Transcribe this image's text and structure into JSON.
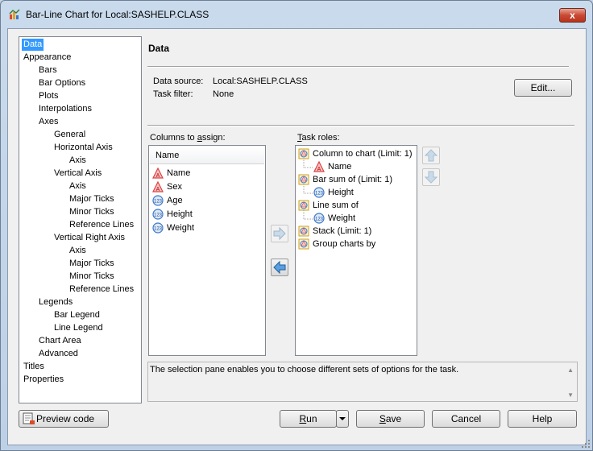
{
  "window": {
    "title": "Bar-Line Chart for Local:SASHELP.CLASS",
    "close_label": "x"
  },
  "tree": {
    "items": [
      {
        "label": "Data",
        "level": 0,
        "selected": true
      },
      {
        "label": "Appearance",
        "level": 0
      },
      {
        "label": "Bars",
        "level": 1
      },
      {
        "label": "Bar Options",
        "level": 1
      },
      {
        "label": "Plots",
        "level": 1
      },
      {
        "label": "Interpolations",
        "level": 1
      },
      {
        "label": "Axes",
        "level": 1
      },
      {
        "label": "General",
        "level": 2
      },
      {
        "label": "Horizontal Axis",
        "level": 2
      },
      {
        "label": "Axis",
        "level": 3
      },
      {
        "label": "Vertical Axis",
        "level": 2
      },
      {
        "label": "Axis",
        "level": 3
      },
      {
        "label": "Major Ticks",
        "level": 3
      },
      {
        "label": "Minor Ticks",
        "level": 3
      },
      {
        "label": "Reference Lines",
        "level": 3
      },
      {
        "label": "Vertical Right Axis",
        "level": 2
      },
      {
        "label": "Axis",
        "level": 3
      },
      {
        "label": "Major Ticks",
        "level": 3
      },
      {
        "label": "Minor Ticks",
        "level": 3
      },
      {
        "label": "Reference Lines",
        "level": 3
      },
      {
        "label": "Legends",
        "level": 1
      },
      {
        "label": "Bar Legend",
        "level": 2
      },
      {
        "label": "Line Legend",
        "level": 2
      },
      {
        "label": "Chart Area",
        "level": 1
      },
      {
        "label": "Advanced",
        "level": 1
      },
      {
        "label": "Titles",
        "level": 0
      },
      {
        "label": "Properties",
        "level": 0
      }
    ]
  },
  "panel": {
    "title": "Data",
    "data_source_label": "Data source:",
    "data_source_value": "Local:SASHELP.CLASS",
    "task_filter_label": "Task filter:",
    "task_filter_value": "None",
    "edit_button": "Edit..."
  },
  "columns": {
    "label_pre": "Columns to ",
    "label_key": "a",
    "label_post": "ssign:",
    "header": "Name",
    "items": [
      {
        "label": "Name",
        "type": "char"
      },
      {
        "label": "Sex",
        "type": "char"
      },
      {
        "label": "Age",
        "type": "num"
      },
      {
        "label": "Height",
        "type": "num"
      },
      {
        "label": "Weight",
        "type": "num"
      }
    ]
  },
  "roles": {
    "label_key": "T",
    "label_post": "ask roles:",
    "items": [
      {
        "label": "Column to chart  (Limit: 1)",
        "kind": "role"
      },
      {
        "label": "Name",
        "kind": "char-child"
      },
      {
        "label": "Bar sum of  (Limit: 1)",
        "kind": "role"
      },
      {
        "label": "Height",
        "kind": "num-child"
      },
      {
        "label": "Line sum of",
        "kind": "role"
      },
      {
        "label": "Weight",
        "kind": "num-child"
      },
      {
        "label": "Stack  (Limit: 1)",
        "kind": "role"
      },
      {
        "label": "Group charts by",
        "kind": "role"
      }
    ]
  },
  "status": {
    "text": "The selection pane enables you to choose different sets of options for the task."
  },
  "footer": {
    "preview_button": "Preview code",
    "run_key": "R",
    "run_post": "un",
    "save_key": "S",
    "save_post": "ave",
    "cancel_button": "Cancel",
    "help_button": "Help"
  },
  "colors": {
    "selection": "#3399ff",
    "char_icon": "#e04040",
    "num_icon": "#3a78c8",
    "arrow": "#3a8ad8"
  }
}
